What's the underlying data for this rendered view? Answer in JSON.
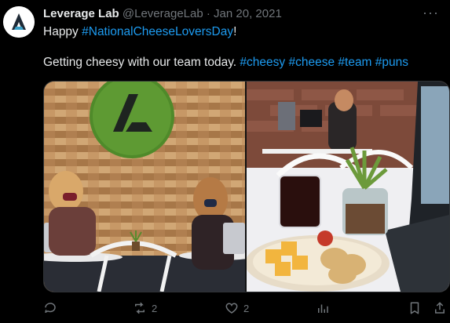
{
  "tweet": {
    "author_name": "Leverage Lab",
    "handle": "@LeverageLab",
    "separator": "·",
    "date": "Jan 20, 2021",
    "more_label": "···",
    "line1_prefix": "Happy ",
    "line1_tag": "#NationalCheeseLoversDay",
    "line1_suffix": "!",
    "line2_text": "Getting cheesy with our team today. ",
    "line2_tags": [
      "#cheesy",
      "#cheese",
      "#team",
      "#puns"
    ]
  },
  "actions": {
    "reply_icon": "reply-icon",
    "retweet_icon": "retweet-icon",
    "retweet_count": "2",
    "like_icon": "heart-icon",
    "like_count": "2",
    "views_icon": "bar-chart-icon",
    "bookmark_icon": "bookmark-icon",
    "share_icon": "share-icon"
  },
  "colors": {
    "background": "#000000",
    "text": "#e7e9ea",
    "muted": "#71767b",
    "link": "#1d9bf0"
  }
}
